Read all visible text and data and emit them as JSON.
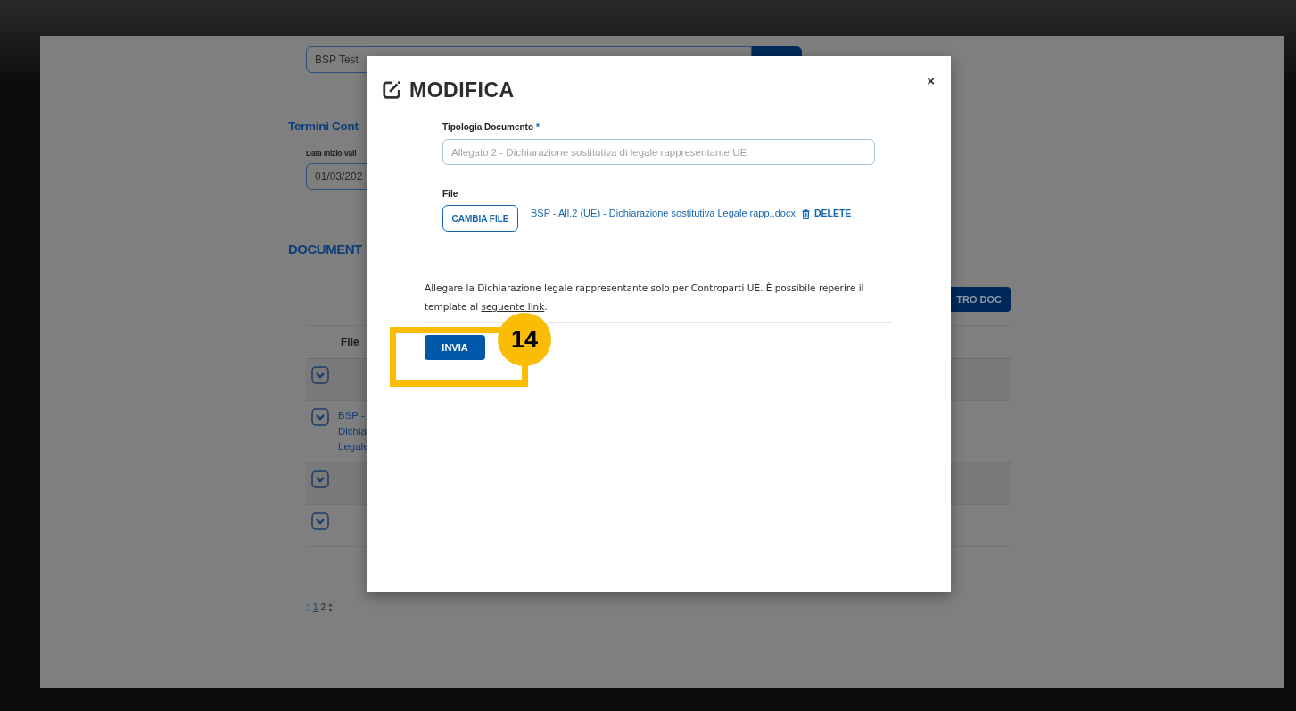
{
  "background_page": {
    "contact_field": {
      "value": "BSP Test"
    },
    "section_title": "Termini Cont",
    "start_date_label": "Data Inizio Vali",
    "start_date_field": {
      "value": "01/03/202"
    },
    "documents_title": "DOCUMENT",
    "add_document_button": "TRO DOC",
    "table": {
      "columns": [
        "File"
      ],
      "rows": [
        {
          "expanded": false,
          "file_lines": []
        },
        {
          "expanded": false,
          "file_lines": [
            "BSP -",
            "Dichia",
            "Legale"
          ]
        },
        {
          "expanded": false,
          "file_lines": []
        },
        {
          "expanded": false,
          "file_lines": []
        }
      ]
    },
    "pagination": [
      {
        "label": "1",
        "selected": false
      },
      {
        "label": "2",
        "selected": true
      }
    ]
  },
  "modal": {
    "title": "MODIFICA",
    "close": "×",
    "document_type": {
      "label": "Tipologia Documento",
      "required_mark": "*",
      "value": "Allegato 2 - Dichiarazione sostitutiva di legale rappresentante UE",
      "disabled": true
    },
    "file": {
      "label": "File",
      "change_button": "CAMBIA FILE",
      "file_name": "BSP - All.2 (UE) - Dichiarazione sostitutiva Legale rapp..docx",
      "delete_button": "DELETE"
    },
    "note": {
      "text": "Allegare la Dichiarazione legale rappresentante solo per Controparti UE. È possibile reperire il template al ",
      "link": "seguente link",
      "end": "."
    },
    "submit_button": "INVIA"
  },
  "annotation": {
    "step": "14"
  }
}
